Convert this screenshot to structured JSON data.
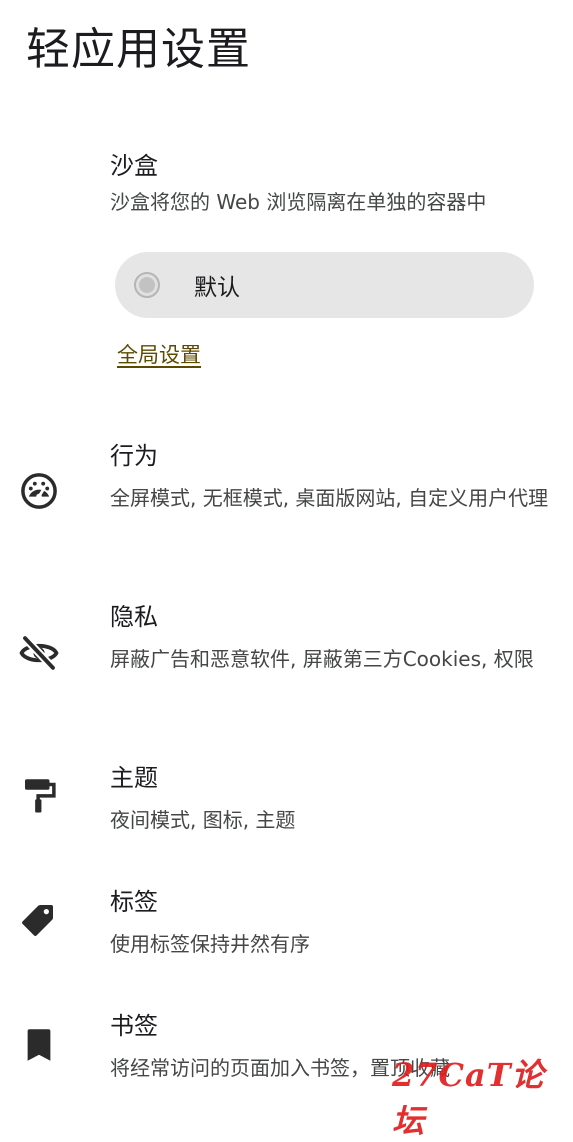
{
  "header": {
    "title": "轻应用设置"
  },
  "sandbox": {
    "title": "沙盒",
    "description": "沙盒将您的 Web 浏览隔离在单独的容器中",
    "option": {
      "label": "默认",
      "selected": false
    },
    "global_link": "全局设置"
  },
  "items": [
    {
      "icon": "dashboard-gauge-icon",
      "title": "行为",
      "description": "全屏模式, 无框模式, 桌面版网站, 自定义用户代理"
    },
    {
      "icon": "eye-off-icon",
      "title": "隐私",
      "description": "屏蔽广告和恶意软件, 屏蔽第三方Cookies, 权限"
    },
    {
      "icon": "paint-roller-icon",
      "title": "主题",
      "description": "夜间模式, 图标, 主题"
    },
    {
      "icon": "tag-icon",
      "title": "标签",
      "description": "使用标签保持井然有序"
    },
    {
      "icon": "bookmark-icon",
      "title": "书签",
      "description": "将经常访问的页面加入书签，置顶收藏"
    }
  ],
  "watermark": {
    "text": "27CaT论坛",
    "color": "#e01e1e"
  },
  "colors": {
    "background": "#ffffff",
    "pill": "#e6e6e6",
    "link": "#5c4a00",
    "icon": "#2b2b2b"
  }
}
